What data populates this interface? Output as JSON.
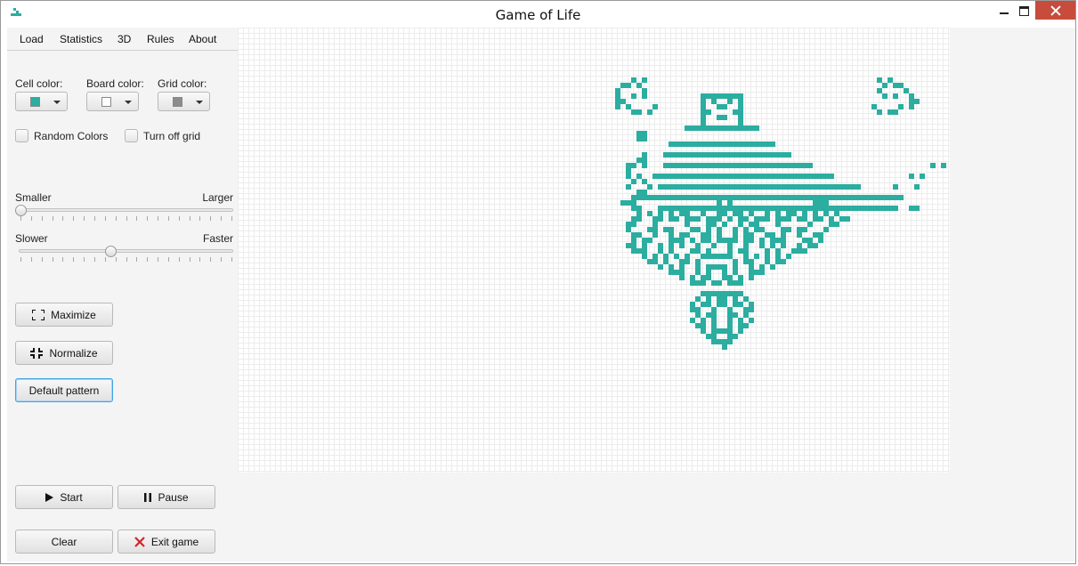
{
  "window": {
    "title": "Game of Life",
    "icon": "app-icon"
  },
  "menu": {
    "items": [
      "Load",
      "Statistics",
      "3D",
      "Rules",
      "About"
    ]
  },
  "colors": {
    "cell_label": "Cell color:",
    "cell_value": "#2bada0",
    "board_label": "Board color:",
    "board_value": "#ffffff",
    "grid_label": "Grid color:",
    "grid_value": "#8c8c8c"
  },
  "options": {
    "random_colors": "Random Colors",
    "turn_off_grid": "Turn off grid",
    "random_checked": false,
    "grid_off_checked": false
  },
  "size_slider": {
    "min_label": "Smaller",
    "max_label": "Larger",
    "value": 0.0
  },
  "speed_slider": {
    "min_label": "Slower",
    "max_label": "Faster",
    "value": 0.43
  },
  "buttons": {
    "maximize": "Maximize",
    "normalize": "Normalize",
    "default_pattern": "Default pattern",
    "start": "Start",
    "pause": "Pause",
    "clear": "Clear",
    "exit": "Exit game"
  },
  "icons": {
    "maximize": "maximize-corners-icon",
    "normalize": "normalize-corners-icon",
    "start": "play-icon",
    "pause": "pause-icon",
    "exit": "close-x-icon"
  },
  "board": {
    "cell_color": "#2bada0",
    "grid_color": "#ececec",
    "cell_size": 6,
    "pattern": [
      "........................................................................................................................................",
      ".........................................X.X...........................................X.X.........................................",
      ".......................................XX.X.............................................X.XX.......................................",
      "......................................X....X...........................................X....X......................................",
      "......................................X..X.X..........XXXXXXXX..........................X.X..X......................................",
      "......................................XX..............X.X..X.X...............................XX......................................",
      "......................................X.X....X........X..XX..X........................X....X.X......................................",
      ".........................................XX.X.........XX....XX.........................X.XX.........................................",
      "......................................................X..XX..X......................................................................",
      "......................................................X......X......................................................................",
      "...................................................XXXXXXXXXXXXXX...................................................................",
      "..........................................XX.........................................................XX..........................",
      "..........................................XX.........................................................XX..........................",
      "................................................XXXXXXXXXXXXXXXXXXXX................................................................",
      "...................................................................................................................................",
      "...........................................X...XXXXXXXXXXXXXXXXXXXXXXXX.............................X...............................",
      "..........................................XX..........................................................XX...........................",
      "........................................XX.X...XXXXXXXXXXXXXXXXXXXXXXXXXXXX......................X.XX..............................",
      "........................................X.....................................................................X....................",
      "........................................X.X..XXXXXXXXXXXXXXXXXXXXXXXXXXXXXXXXXX..............X.X...................................",
      ".........................................X.X..........................................................X.X..........................",
      "........................................X...X.XXXXXXXXXXXXXXXXXXXXXXXXXXXXXXXXXXXXXX......X...X.....................................",
      "..........................................XX.............................................................XX........................",
      ".........................................XXXXXXXXXXXXXXXXXXXXXXXXXXXXXXXXXXXXXXXXXXXXXXXXXXX...........................................",
      ".......................................XXX...............X.X...............XXX......................................................",
      ".........................................XX...XXXXXXXXXXXXXXXXXXXXXXXXXXXXXXXXXXXXXXXXXXXXX..XX.....................................",
      "..........................................X.X.X.X.XX..X..XX.XX.X..X.X.XX.X.X.X.X......................................................",
      ".........................................XX..XX.XX.XXX.XXX.X.XX.XXX.XXX.XX.XX.X.XX...................................................",
      "........................................XX...X.....X...XX.X..X.XX...X.....X...XX....................................................",
      "........................................X...XX.XX...XX.X.X..X.X.XX...XX.XX...X.....................................................",
      ".........................................XX..X..X.XX..XX.X..X.XX..XX.X..X..XX.......................................................",
      ".........................................X.XX...XXX.X.XX.XXXX.XX.X.XXX...XX.X.......................................................",
      "........................................XX.X..X.X.X..X..X..X..X..X.X.X..X.XX........................................................",
      ".........................................XXX..X.X...XX.X...X.XX...X.X..XXX.........................................................",
      "...........................................X.X.X.X.X..XXXXXX..X.X.X.X.X............................................................",
      "............................................XX.X..XX.X......X.XX..X.XX..............................................................",
      "..............................................X.X.X..X.XXXX.X..X.X.X................................................................",
      "................................................XXX..X.X..X.X..XXX..................................................................",
      "..................................................X.X.XX..XX.X.X....................................................................",
      "....................................................XXX.XX.XXX......................................................................",
      "....................................................................................................................................",
      "......................................................XXXXXXXX.......................................................................",
      ".....................................................X.X.XX.X.X.....................................................................",
      "....................................................X.XX.XX.XX.X....................................................................",
      "....................................................XX..X..X..XX....................................................................",
      ".....................................................X.XX..XX.X.....................................................................",
      "....................................................X.X.X..X.X.X....................................................................",
      ".....................................................XX.X..X.XX.....................................................................",
      "......................................................X.XXXX.X......................................................................",
      ".......................................................XX..XX.......................................................................",
      "........................................................XXXX........................................................................",
      "..........................................................X.........................................................................."
    ]
  }
}
